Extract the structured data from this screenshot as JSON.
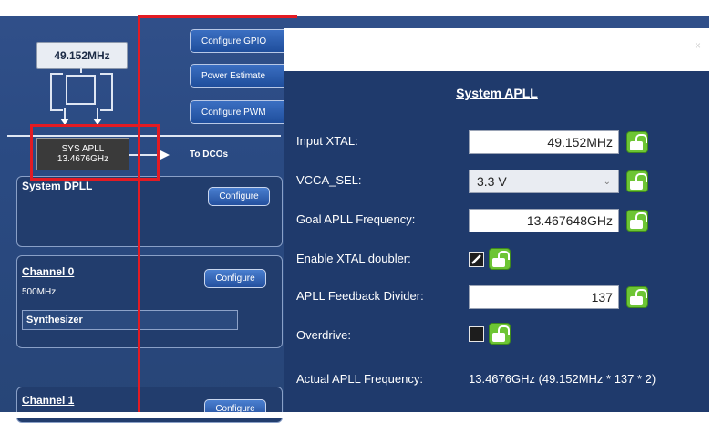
{
  "diagram": {
    "xtal_label": "49.152MHz",
    "sys_apll_line1": "SYS APLL",
    "sys_apll_line2": "13.4676GHz",
    "to_dcos": "To DCOs",
    "buttons": [
      "Configure GPIO",
      "Power Estimate",
      "Configure PWM"
    ]
  },
  "panels": {
    "system_dpll": {
      "title": "System DPLL",
      "button": "Configure"
    },
    "channel0": {
      "title": "Channel 0",
      "freq": "500MHz",
      "mode": "Synthesizer",
      "button": "Configure"
    },
    "channel1": {
      "title": "Channel 1",
      "button": "Configure"
    }
  },
  "dialog": {
    "close": "×",
    "heading": "System APLL",
    "input_xtal": {
      "label": "Input XTAL:",
      "value": "49.152MHz"
    },
    "vcca_sel": {
      "label": "VCCA_SEL:",
      "value": "3.3 V"
    },
    "goal_freq": {
      "label": "Goal APLL Frequency:",
      "value": "13.467648GHz"
    },
    "xtal_doubler": {
      "label": "Enable XTAL doubler:",
      "checked": true
    },
    "feedback_div": {
      "label": "APLL Feedback Divider:",
      "value": "137"
    },
    "overdrive": {
      "label": "Overdrive:",
      "checked": false
    },
    "actual": {
      "label": "Actual APLL Frequency:",
      "value": "13.4676GHz (49.152MHz * 137 * 2)"
    }
  },
  "colors": {
    "annotation": "#e31b23",
    "lock": "#6dc534",
    "panel": "#223d6d"
  }
}
